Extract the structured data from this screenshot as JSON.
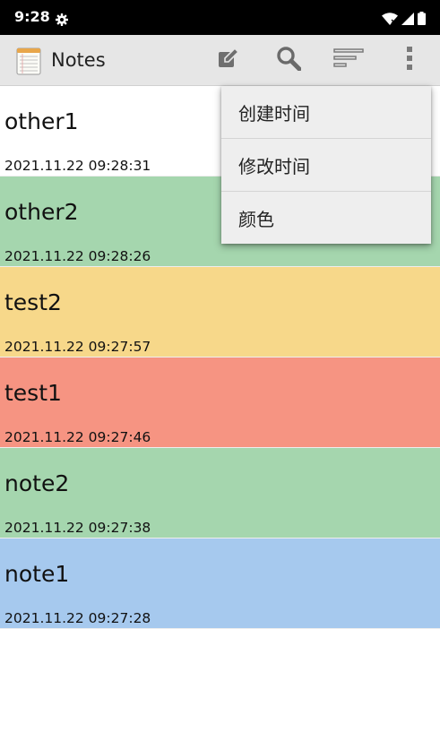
{
  "status_bar": {
    "time": "9:28",
    "icons": [
      "gear-icon",
      "wifi-icon",
      "signal-icon",
      "battery-icon"
    ]
  },
  "app_bar": {
    "title": "Notes",
    "icons": [
      "notes-app-icon",
      "edit-note-icon",
      "search-icon",
      "sort-icon",
      "overflow-menu-icon"
    ]
  },
  "notes": [
    {
      "title": "other1",
      "time": "2021.11.22 09:28:31",
      "color": "#ffffff"
    },
    {
      "title": "other2",
      "time": "2021.11.22 09:28:26",
      "color": "#a5d6ae"
    },
    {
      "title": "test2",
      "time": "2021.11.22 09:27:57",
      "color": "#f7d88a"
    },
    {
      "title": "test1",
      "time": "2021.11.22 09:27:46",
      "color": "#f69482"
    },
    {
      "title": "note2",
      "time": "2021.11.22 09:27:38",
      "color": "#a5d6ae"
    },
    {
      "title": "note1",
      "time": "2021.11.22 09:27:28",
      "color": "#a6c9ee"
    }
  ],
  "popup_menu": {
    "items": [
      {
        "label": "创建时间"
      },
      {
        "label": "修改时间"
      },
      {
        "label": "颜色"
      }
    ]
  }
}
